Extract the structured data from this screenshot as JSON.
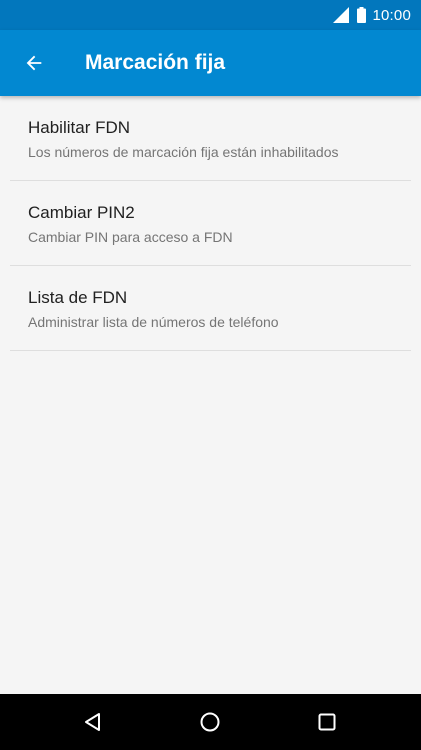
{
  "status_bar": {
    "time": "10:00",
    "icons": [
      "signal-icon",
      "battery-icon"
    ]
  },
  "app_bar": {
    "back_icon": "arrow-back-icon",
    "title": "Marcación fija"
  },
  "settings": [
    {
      "title": "Habilitar FDN",
      "summary": "Los números de marcación fija están inhabilitados"
    },
    {
      "title": "Cambiar PIN2",
      "summary": "Cambiar PIN para acceso a FDN"
    },
    {
      "title": "Lista de FDN",
      "summary": "Administrar lista de números de teléfono"
    }
  ],
  "nav_bar": {
    "icons": [
      "back-triangle-icon",
      "home-circle-icon",
      "recents-square-icon"
    ]
  },
  "colors": {
    "status_bar": "#0277bd",
    "app_bar": "#0288d1",
    "background": "#f5f5f5",
    "nav_bar": "#000000"
  }
}
